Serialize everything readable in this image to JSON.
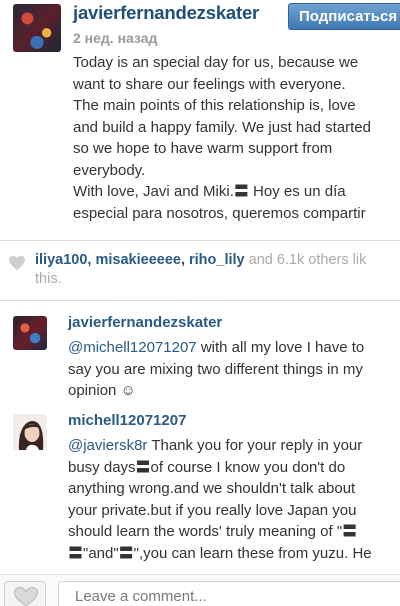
{
  "post": {
    "username": "javierfernandezskater",
    "timestamp": "2 нед. назад",
    "follow_label": "Подписаться",
    "caption": "Today is an special day for us, because we\nwant to share our feelings with everyone.\nThe main points of this relationship is, love\nand build a happy family. We just had started\nso we hope to have warm support from\neverybody.\nWith love, Javi and Miki.〓 Hoy es un día\nespecial para nosotros, queremos compartir"
  },
  "likes": {
    "users": [
      "iliya100",
      "misakieeeee",
      "riho_lily"
    ],
    "separator": ", ",
    "rest": " and 6.1k others lik\nthis."
  },
  "comments": [
    {
      "username": "javierfernandezskater",
      "mention": "@michell12071207",
      "text": " with all my love I have to\nsay you are mixing two different things in my\nopinion ☺"
    },
    {
      "username": "michell12071207",
      "mention": "@javiersk8r",
      "text": " Thank you for your reply in your\nbusy days〓of course I know you don't do\nanything wrong.and we shouldn't talk about\nyour private.but if you really love Japan you\nshould learn the words' truly meaning of \"〓\n〓\"and\"〓\",you can learn these from yuzu. He"
    }
  ],
  "footer": {
    "input_placeholder": "Leave a comment..."
  },
  "icons": {
    "likes_heart": "heart-icon",
    "like_button": "heart-outline-icon"
  },
  "colors": {
    "link": "#2a5a86",
    "username": "#1f4f7a",
    "follow_button": "#3f79b3",
    "muted": "#aaaaaa"
  }
}
